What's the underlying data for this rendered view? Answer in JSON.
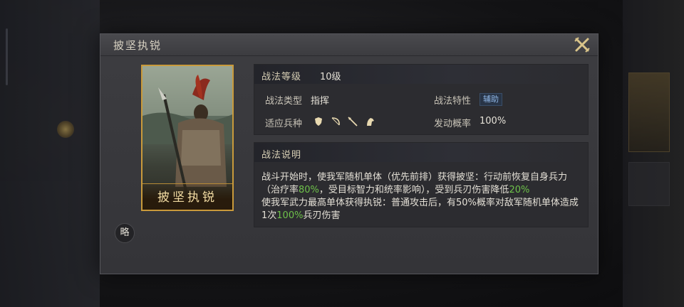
{
  "dialog": {
    "title": "披坚执锐",
    "card_name": "披坚执锐",
    "side_button": "略"
  },
  "level": {
    "label": "战法等级",
    "value": "10级"
  },
  "info": {
    "type_label": "战法类型",
    "type_value": "指挥",
    "trait_label": "战法特性",
    "trait_value": "辅助",
    "troop_label": "适应兵种",
    "troop_icons": [
      "shield-icon",
      "bow-icon",
      "spear-icon",
      "horse-icon"
    ],
    "rate_label": "发动概率",
    "rate_value": "100%"
  },
  "description": {
    "header": "战法说明",
    "line1": "战斗开始时，使我军随机单体（优先前排）获得披坚：行动前恢复自身兵力（治疗率",
    "v1": "80%",
    "line2": "，受目标智力和统率影响），受到兵刃伤害降低",
    "v2": "20%",
    "line3": "使我军武力最高单体获得执锐：普通攻击后，有50%概率对敌军随机单体造成1次",
    "v3": "100%",
    "line4": "兵刃伤害"
  },
  "colors": {
    "accent_gold": "#c99a3b",
    "highlight_green": "#6ec24a",
    "trait_blue": "#8fb6e6"
  }
}
